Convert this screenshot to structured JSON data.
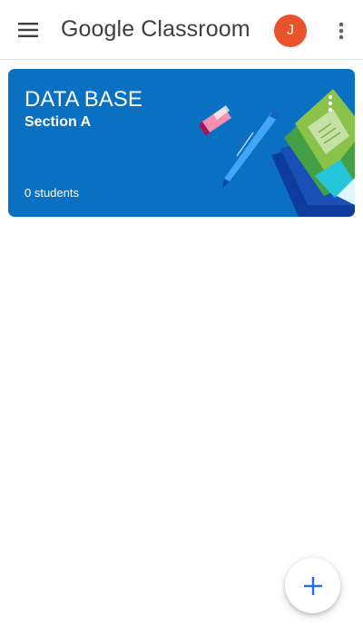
{
  "appbar": {
    "title": "Google Classroom",
    "menu_icon": "hamburger-menu-icon",
    "overflow_icon": "more-vert-icon",
    "avatar": {
      "initial": "J",
      "color": "#e8532b"
    }
  },
  "courses": [
    {
      "title": "DATA BASE",
      "section": "Section A",
      "students": "0 students",
      "menu_icon": "more-vert-icon",
      "color": "#0a70c1"
    }
  ],
  "fab": {
    "icon": "plus-icon",
    "color": "#1a73e8"
  }
}
